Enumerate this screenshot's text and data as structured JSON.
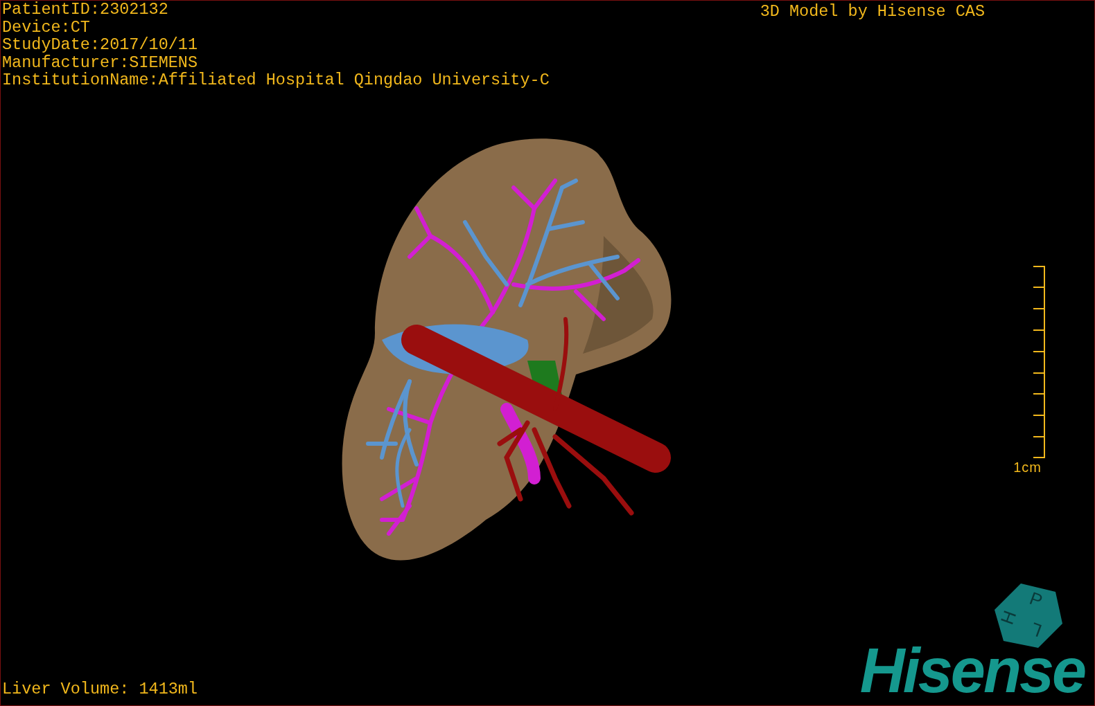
{
  "viewer": {
    "patient_info": [
      "PatientID:2302132",
      "Device:CT",
      "StudyDate:2017/10/11",
      "Manufacturer:SIEMENS",
      "InstitutionName:Affiliated Hospital Qingdao University-C"
    ],
    "title": "3D Model by Hisense CAS",
    "scale_bar": {
      "label": "1cm"
    },
    "orientation_cube": {
      "labels": [
        "P",
        "H",
        "L"
      ]
    },
    "logo": "Hisense",
    "liver_volume": "Liver Volume: 1413ml"
  }
}
